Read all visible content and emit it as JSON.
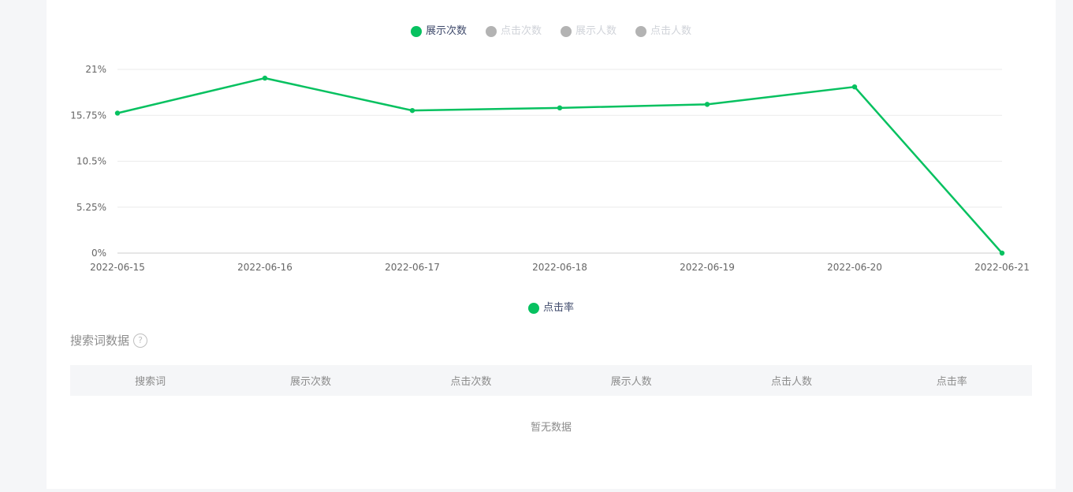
{
  "legend_top": [
    {
      "label": "展示次数",
      "color": "#07c160",
      "active": true
    },
    {
      "label": "点击次数",
      "color": "#b3b3b3",
      "active": false
    },
    {
      "label": "展示人数",
      "color": "#b3b3b3",
      "active": false
    },
    {
      "label": "点击人数",
      "color": "#b3b3b3",
      "active": false
    }
  ],
  "chart_data": {
    "type": "line",
    "x": [
      "2022-06-15",
      "2022-06-16",
      "2022-06-17",
      "2022-06-18",
      "2022-06-19",
      "2022-06-20",
      "2022-06-21"
    ],
    "series": [
      {
        "name": "点击率",
        "color": "#07c160",
        "values": [
          16.0,
          20.0,
          16.3,
          16.6,
          17.0,
          19.0,
          0
        ]
      }
    ],
    "yticks": [
      "0%",
      "5.25%",
      "10.5%",
      "15.75%",
      "21%"
    ],
    "ylim": [
      0,
      21
    ],
    "grid": true
  },
  "legend_bottom": {
    "label": "点击率",
    "color": "#07c160"
  },
  "section": {
    "title": "搜索词数据",
    "help": "?"
  },
  "table": {
    "columns": [
      "搜索词",
      "展示次数",
      "点击次数",
      "展示人数",
      "点击人数",
      "点击率"
    ],
    "empty_text": "暂无数据"
  }
}
